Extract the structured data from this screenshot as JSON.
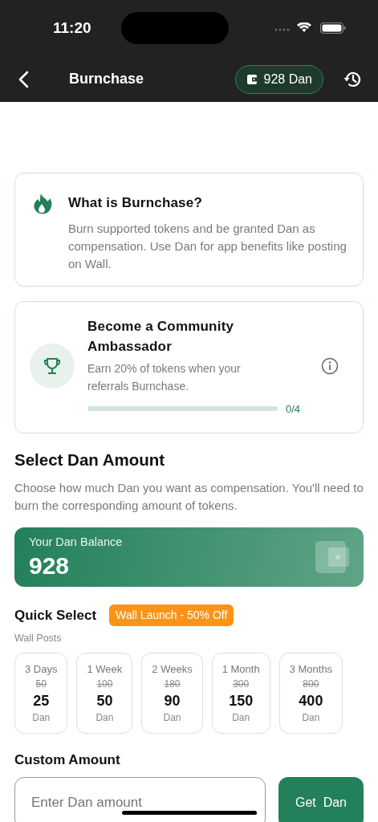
{
  "status_bar": {
    "time": "11:20"
  },
  "header": {
    "title": "Burnchase",
    "balance_chip": "928 Dan"
  },
  "info_card": {
    "title": "What is Burnchase?",
    "text": "Burn supported tokens and be granted Dan as compensation. Use Dan for app benefits like posting on Wall."
  },
  "ambassador_card": {
    "title": "Become a Community Ambassador",
    "text": "Earn 20% of tokens when your referrals Burnchase.",
    "progress": {
      "level": 0,
      "reading": "0/4"
    }
  },
  "select_section": {
    "title": "Select Dan Amount",
    "text": "Choose how much Dan you want as compensation. You'll need to burn the corresponding amount of tokens."
  },
  "balance_card": {
    "label": "Your Dan Balance",
    "value": "928"
  },
  "quick_select": {
    "title": "Quick Select",
    "badge": "Wall Launch - 50% Off",
    "subtitle": "Wall Posts",
    "options": [
      {
        "duration": "3 Days",
        "old_price": "50",
        "price": "25",
        "unit": "Dan",
        "selected": false
      },
      {
        "duration": "1 Week",
        "old_price": "100",
        "price": "50",
        "unit": "Dan",
        "selected": false
      },
      {
        "duration": "2 Weeks",
        "old_price": "180",
        "price": "90",
        "unit": "Dan",
        "selected": false
      },
      {
        "duration": "1 Month",
        "old_price": "300",
        "price": "150",
        "unit": "Dan",
        "selected": false
      },
      {
        "duration": "3 Months",
        "old_price": "800",
        "price": "400",
        "unit": "Dan",
        "selected": false
      }
    ]
  },
  "custom_amount": {
    "title": "Custom Amount",
    "placeholder": "Enter Dan amount",
    "button": "Get  Dan"
  }
}
